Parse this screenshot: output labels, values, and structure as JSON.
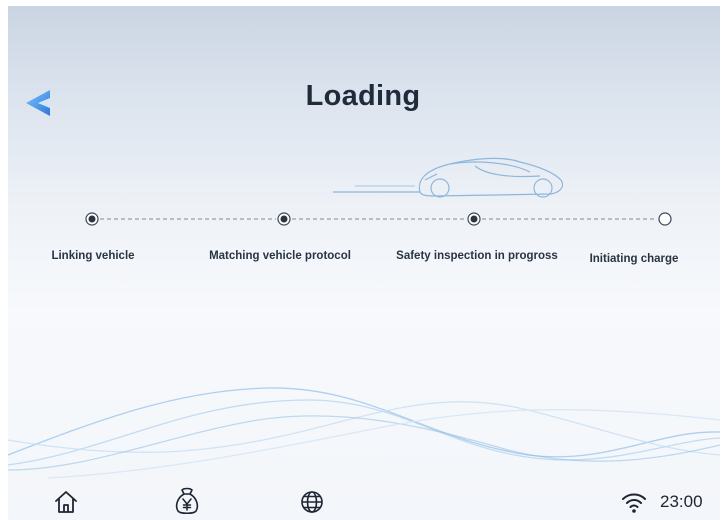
{
  "header": {
    "title": "Loading",
    "back_icon": "back-arrow-icon"
  },
  "progress": {
    "steps": [
      {
        "label": "Linking vehicle",
        "state": "complete"
      },
      {
        "label": "Matching vehicle protocol",
        "state": "complete"
      },
      {
        "label": "Safety inspection in progross",
        "state": "complete"
      },
      {
        "label": "Initiating charge",
        "state": "pending"
      }
    ]
  },
  "bottom_bar": {
    "icons": [
      "home-icon",
      "money-bag-yen-icon",
      "globe-icon"
    ],
    "status": {
      "wifi_icon": "wifi-icon",
      "time": "23:00"
    }
  },
  "colors": {
    "accent": "#3a8fd8",
    "title": "#1f2a3a",
    "line": "#9bbfe0"
  }
}
